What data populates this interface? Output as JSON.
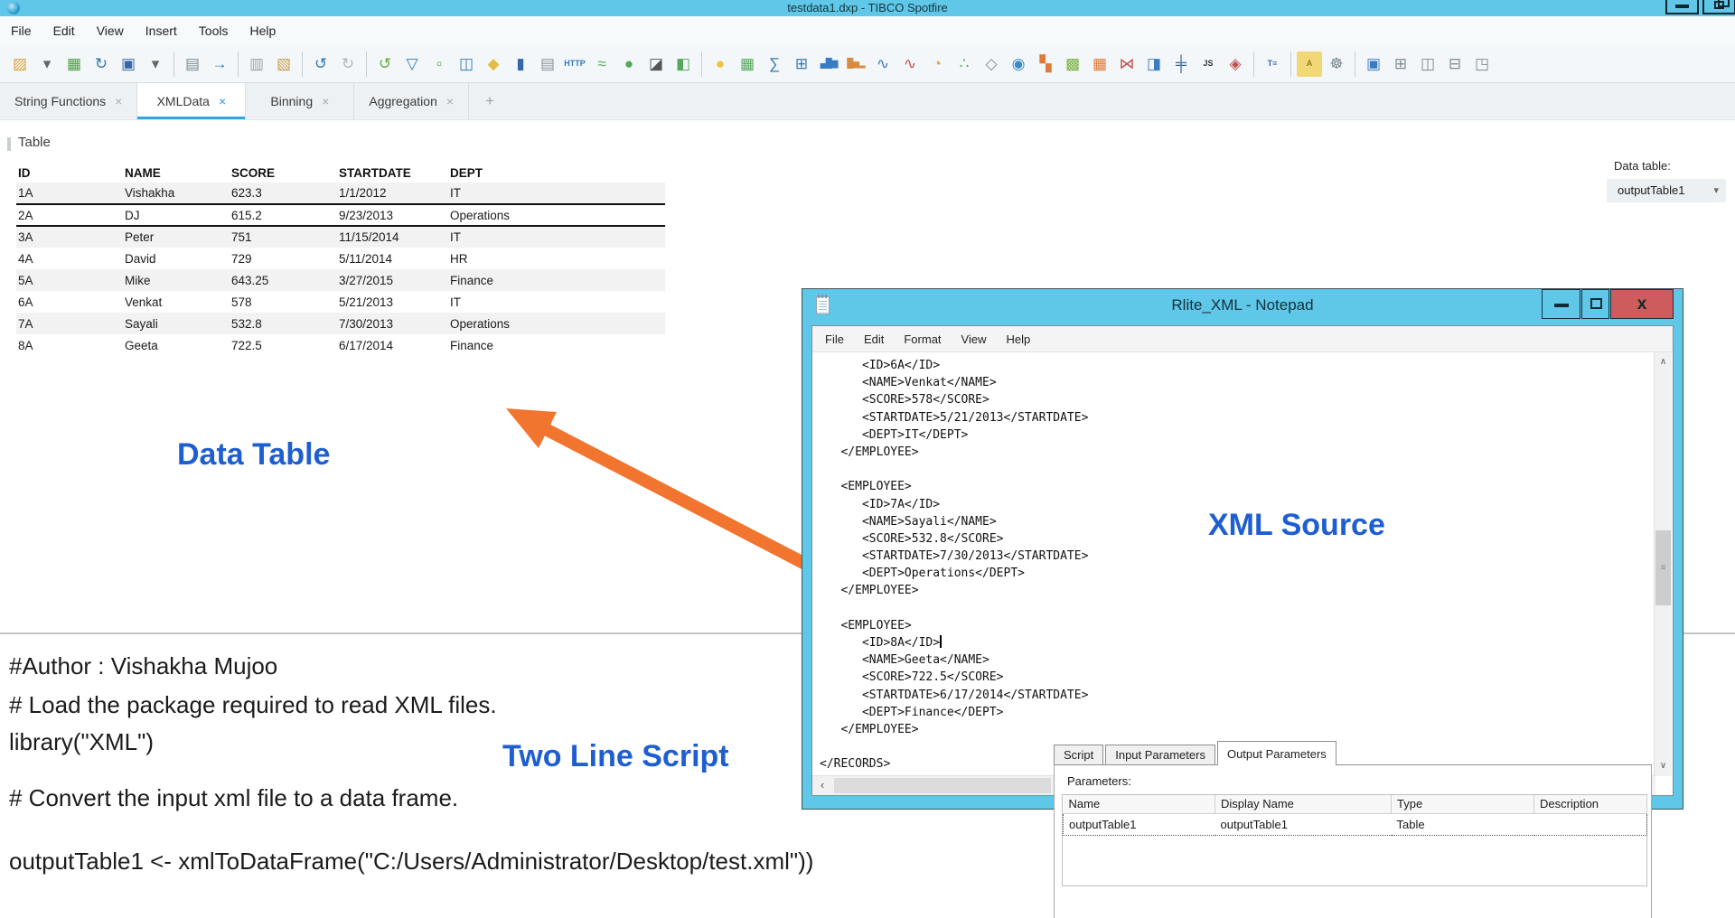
{
  "app_window": {
    "title": "testdata1.dxp - TIBCO Spotfire"
  },
  "menu_bar": {
    "items": [
      "File",
      "Edit",
      "View",
      "Insert",
      "Tools",
      "Help"
    ]
  },
  "toolbar": {
    "items": [
      {
        "name": "open-file-icon",
        "glyph": "▨",
        "color": "#dca43e"
      },
      {
        "name": "open-file-dropdown-icon",
        "glyph": "▾",
        "color": "#666666"
      },
      {
        "name": "add-data-tables-icon",
        "glyph": "▦",
        "color": "#4d9e45"
      },
      {
        "name": "reload-data-icon",
        "glyph": "↻",
        "color": "#3379b7"
      },
      {
        "name": "save-icon",
        "glyph": "▣",
        "color": "#3668a8"
      },
      {
        "name": "save-dropdown-icon",
        "glyph": "▾",
        "color": "#666666"
      },
      {
        "separator": true
      },
      {
        "name": "print-icon",
        "glyph": "▤",
        "color": "#7d8a93"
      },
      {
        "name": "export-presentation-icon",
        "glyph": "→",
        "color": "#3379b7"
      },
      {
        "separator": true
      },
      {
        "name": "copy-icon",
        "glyph": "▥",
        "color": "#9aa4ab"
      },
      {
        "name": "paste-icon",
        "glyph": "▧",
        "color": "#c59f4e"
      },
      {
        "separator": true
      },
      {
        "name": "undo-icon",
        "glyph": "↺",
        "color": "#3379b7"
      },
      {
        "name": "redo-icon",
        "glyph": "↻",
        "color": "#b0b8bd"
      },
      {
        "separator": true
      },
      {
        "name": "revert-marking-icon",
        "glyph": "↺",
        "color": "#6aaa3d"
      },
      {
        "name": "filter-icon",
        "glyph": "▽",
        "color": "#3379b7"
      },
      {
        "name": "marking-icon",
        "glyph": "▫",
        "color": "#57a85c"
      },
      {
        "name": "column-organizer-icon",
        "glyph": "◫",
        "color": "#3379b7"
      },
      {
        "name": "tags-icon",
        "glyph": "◆",
        "color": "#e3bd45"
      },
      {
        "name": "bookmarks-icon",
        "glyph": "▮",
        "color": "#3668a8"
      },
      {
        "name": "duplicate-page-icon",
        "glyph": "▤",
        "color": "#8a949c"
      },
      {
        "name": "web-page-icon",
        "glyph": "HTTP",
        "color": "#3379b7",
        "text": true
      },
      {
        "name": "data-relationships-icon",
        "glyph": "≈",
        "color": "#57a85c"
      },
      {
        "name": "comments-icon",
        "glyph": "●",
        "color": "#57a85c"
      },
      {
        "name": "display-mode-icon",
        "glyph": "◪",
        "color": "#555555"
      },
      {
        "name": "add-content-icon",
        "glyph": "◧",
        "color": "#57a85c"
      },
      {
        "separator": true
      },
      {
        "name": "recommendations-icon",
        "glyph": "●",
        "color": "#f0c23c"
      },
      {
        "name": "new-table-icon",
        "glyph": "▦",
        "color": "#57a85c"
      },
      {
        "name": "summary-table-icon",
        "glyph": "∑",
        "color": "#3379b7"
      },
      {
        "name": "cross-table-icon",
        "glyph": "⊞",
        "color": "#3379b7"
      },
      {
        "name": "bar-chart-icon",
        "glyph": "▄█▆",
        "color": "#3a7cc4",
        "bars": true
      },
      {
        "name": "waterfall-chart-icon",
        "glyph": "█▅▂",
        "color": "#d98c3f",
        "bars": true
      },
      {
        "name": "line-chart-icon",
        "glyph": "∿",
        "color": "#3a7cc4"
      },
      {
        "name": "combination-chart-icon",
        "glyph": "∿",
        "color": "#c0504d"
      },
      {
        "name": "pie-chart-icon",
        "glyph": "◔",
        "color": "#e0a93e"
      },
      {
        "name": "scatter-plot-icon",
        "glyph": "∴",
        "color": "#57a85c"
      },
      {
        "name": "scatter-3d-icon",
        "glyph": "◇",
        "color": "#7d8a93"
      },
      {
        "name": "map-chart-icon",
        "glyph": "◉",
        "color": "#3a8cc4"
      },
      {
        "name": "treemap-icon",
        "glyph": "▚",
        "color": "#e07b39"
      },
      {
        "name": "heat-map-icon",
        "glyph": "▩",
        "color": "#76b041"
      },
      {
        "name": "kpi-chart-icon",
        "glyph": "▦",
        "color": "#e07b39"
      },
      {
        "name": "parallel-coordinate-icon",
        "glyph": "⋈",
        "color": "#c0504d"
      },
      {
        "name": "details-visualization-icon",
        "glyph": "◨",
        "color": "#3a7cc4"
      },
      {
        "name": "box-plot-icon",
        "glyph": "╪",
        "color": "#3668a8"
      },
      {
        "name": "javascript-icon",
        "glyph": "JS",
        "color": "#333333",
        "text": true
      },
      {
        "name": "graphical-table-icon",
        "glyph": "◈",
        "color": "#c0504d"
      },
      {
        "separator": true
      },
      {
        "name": "text-area-icon",
        "glyph": "T≡",
        "color": "#3668a8",
        "text": true
      },
      {
        "separator": true
      },
      {
        "name": "format-text-icon",
        "glyph": "A",
        "color": "#9a7b1e",
        "text": true,
        "bg": "#f2d777"
      },
      {
        "name": "document-properties-icon",
        "glyph": "☸",
        "color": "#7d8a93"
      },
      {
        "separator": true
      },
      {
        "name": "layout-stack-icon",
        "glyph": "▣",
        "color": "#3a7cc4"
      },
      {
        "name": "layout-grid-icon",
        "glyph": "⊞",
        "color": "#7d8a93"
      },
      {
        "name": "layout-side-by-side-icon",
        "glyph": "◫",
        "color": "#7d8a93"
      },
      {
        "name": "layout-rows-icon",
        "glyph": "⊟",
        "color": "#7d8a93"
      },
      {
        "name": "maximize-visualization-icon",
        "glyph": "◳",
        "color": "#7d8a93"
      }
    ]
  },
  "page_tabs": {
    "items": [
      {
        "label": "String Functions",
        "active": false
      },
      {
        "label": "XMLData",
        "active": true
      },
      {
        "label": "Binning",
        "active": false
      },
      {
        "label": "Aggregation",
        "active": false
      }
    ],
    "close_glyph": "×",
    "new_tab_label": "+"
  },
  "table_visualization": {
    "title": "Table",
    "columns": [
      "ID",
      "NAME",
      "SCORE",
      "STARTDATE",
      "DEPT"
    ],
    "rows": [
      [
        "1A",
        "Vishakha",
        "623.3",
        "1/1/2012",
        "IT"
      ],
      [
        "2A",
        "DJ",
        "615.2",
        "9/23/2013",
        "Operations"
      ],
      [
        "3A",
        "Peter",
        "751",
        "11/15/2014",
        "IT"
      ],
      [
        "4A",
        "David",
        "729",
        "5/11/2014",
        "HR"
      ],
      [
        "5A",
        "Mike",
        "643.25",
        "3/27/2015",
        "Finance"
      ],
      [
        "6A",
        "Venkat",
        "578",
        "5/21/2013",
        "IT"
      ],
      [
        "7A",
        "Sayali",
        "532.8",
        "7/30/2013",
        "Operations"
      ],
      [
        "8A",
        "Geeta",
        "722.5",
        "6/17/2014",
        "Finance"
      ]
    ],
    "marked_row_index": 1
  },
  "data_table_selector": {
    "label": "Data table:",
    "value": "outputTable1",
    "arrow": "▾"
  },
  "annotations": {
    "data_table": "Data Table",
    "xml_source": "XML Source",
    "two_line_script": "Two Line Script"
  },
  "script_area": {
    "lines": [
      "#Author : Vishakha Mujoo",
      "# Load the package required to read XML files.",
      "library(\"XML\")",
      "# Convert the input xml file to a data frame.",
      "outputTable1 <- xmlToDataFrame(\"C:/Users/Administrator/Desktop/test.xml\"))"
    ]
  },
  "notepad": {
    "title": "Rlite_XML - Notepad",
    "menu": [
      "File",
      "Edit",
      "Format",
      "View",
      "Help"
    ],
    "xml_lines": [
      "      <ID>6A</ID>",
      "      <NAME>Venkat</NAME>",
      "      <SCORE>578</SCORE>",
      "      <STARTDATE>5/21/2013</STARTDATE>",
      "      <DEPT>IT</DEPT>",
      "   </EMPLOYEE>",
      "",
      "   <EMPLOYEE>",
      "      <ID>7A</ID>",
      "      <NAME>Sayali</NAME>",
      "      <SCORE>532.8</SCORE>",
      "      <STARTDATE>7/30/2013</STARTDATE>",
      "      <DEPT>Operations</DEPT>",
      "   </EMPLOYEE>",
      "",
      "   <EMPLOYEE>",
      "      <ID>8A</ID>",
      "      <NAME>Geeta</NAME>",
      "      <SCORE>722.5</SCORE>",
      "      <STARTDATE>6/17/2014</STARTDATE>",
      "      <DEPT>Finance</DEPT>",
      "   </EMPLOYEE>",
      "",
      "</RECORDS>"
    ],
    "cursor_line_index": 16,
    "scroll_up_glyph": "∧",
    "scroll_down_glyph": "∨",
    "scroll_left_glyph": "‹",
    "thumb_grip_glyph": "≡"
  },
  "parameters_panel": {
    "tabs": [
      {
        "label": "Script",
        "active": false
      },
      {
        "label": "Input Parameters",
        "active": false
      },
      {
        "label": "Output Parameters",
        "active": true
      }
    ],
    "parameters_label": "Parameters:",
    "columns": [
      "Name",
      "Display Name",
      "Type",
      "Description"
    ],
    "rows": [
      [
        "outputTable1",
        "outputTable1",
        "Table",
        ""
      ]
    ]
  },
  "colors": {
    "titlebar_blue": "#60c7e8",
    "annotation_blue": "#1e5ed1",
    "arrow_orange": "#f2752f",
    "close_button_red": "#ce5c5c",
    "active_tab_underline": "#2ea7de",
    "row_stripe": "#f2f2f2"
  }
}
